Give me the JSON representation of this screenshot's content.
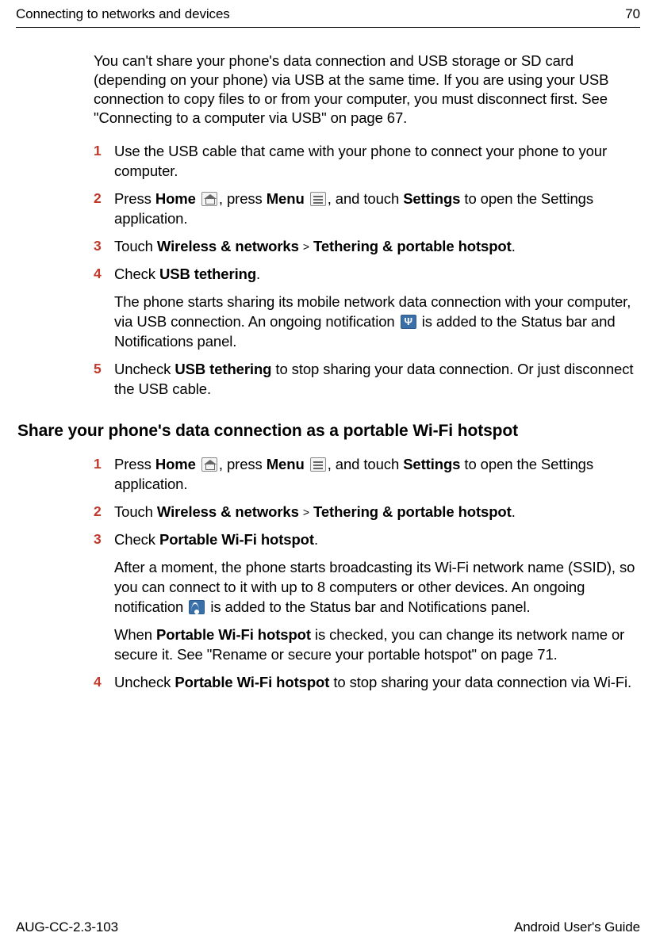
{
  "header": {
    "title": "Connecting to networks and devices",
    "page": "70"
  },
  "intro": "You can't share your phone's data connection and USB storage or SD card (depending on your phone) via USB at the same time. If you are using your USB connection to copy files to or from your computer, you must disconnect first. See \"Connecting to a computer via USB\" on page 67.",
  "section1_steps": {
    "s1": "Use the USB cable that came with your phone to connect your phone to your computer.",
    "s2_a": "Press ",
    "s2_home": "Home",
    "s2_b": ", press ",
    "s2_menu": "Menu",
    "s2_c": ", and touch ",
    "s2_settings": "Settings",
    "s2_d": " to open the Settings application.",
    "s3_a": "Touch ",
    "s3_b": "Wireless & networks",
    "s3_c": "Tethering & portable hotspot",
    "s3_d": ".",
    "s4_a": "Check ",
    "s4_b": "USB tethering",
    "s4_c": ".",
    "s4_extra_a": "The phone starts sharing its mobile network data connection with your computer, via USB connection. An ongoing notification ",
    "s4_extra_b": " is added to the Status bar and Notifications panel.",
    "s5_a": "Uncheck ",
    "s5_b": "USB tethering",
    "s5_c": " to stop sharing your data connection. Or just disconnect the USB cable."
  },
  "section2_heading": "Share your phone's data connection as a portable Wi-Fi hotspot",
  "section2_steps": {
    "s1_a": "Press ",
    "s1_home": "Home",
    "s1_b": ", press ",
    "s1_menu": "Menu",
    "s1_c": ", and touch ",
    "s1_settings": "Settings",
    "s1_d": " to open the Settings application.",
    "s2_a": "Touch ",
    "s2_b": "Wireless & networks",
    "s2_c": "Tethering & portable hotspot",
    "s2_d": ".",
    "s3_a": "Check ",
    "s3_b": "Portable Wi-Fi hotspot",
    "s3_c": ".",
    "s3_extra1_a": "After a moment, the phone starts broadcasting its Wi-Fi network name (SSID), so you can connect to it with up to 8 computers or other devices. An ongoing notification ",
    "s3_extra1_b": " is added to the Status bar and Notifications panel.",
    "s3_extra2_a": "When ",
    "s3_extra2_b": "Portable Wi-Fi hotspot",
    "s3_extra2_c": " is checked, you can change its network name or secure it. See \"Rename or secure your portable hotspot\" on page 71.",
    "s4_a": "Uncheck ",
    "s4_b": "Portable Wi-Fi hotspot",
    "s4_c": " to stop sharing your data connection via Wi-Fi."
  },
  "footer": {
    "left": "AUG-CC-2.3-103",
    "right": "Android User's Guide"
  },
  "nums": {
    "n1": "1",
    "n2": "2",
    "n3": "3",
    "n4": "4",
    "n5": "5"
  },
  "chev": ">"
}
